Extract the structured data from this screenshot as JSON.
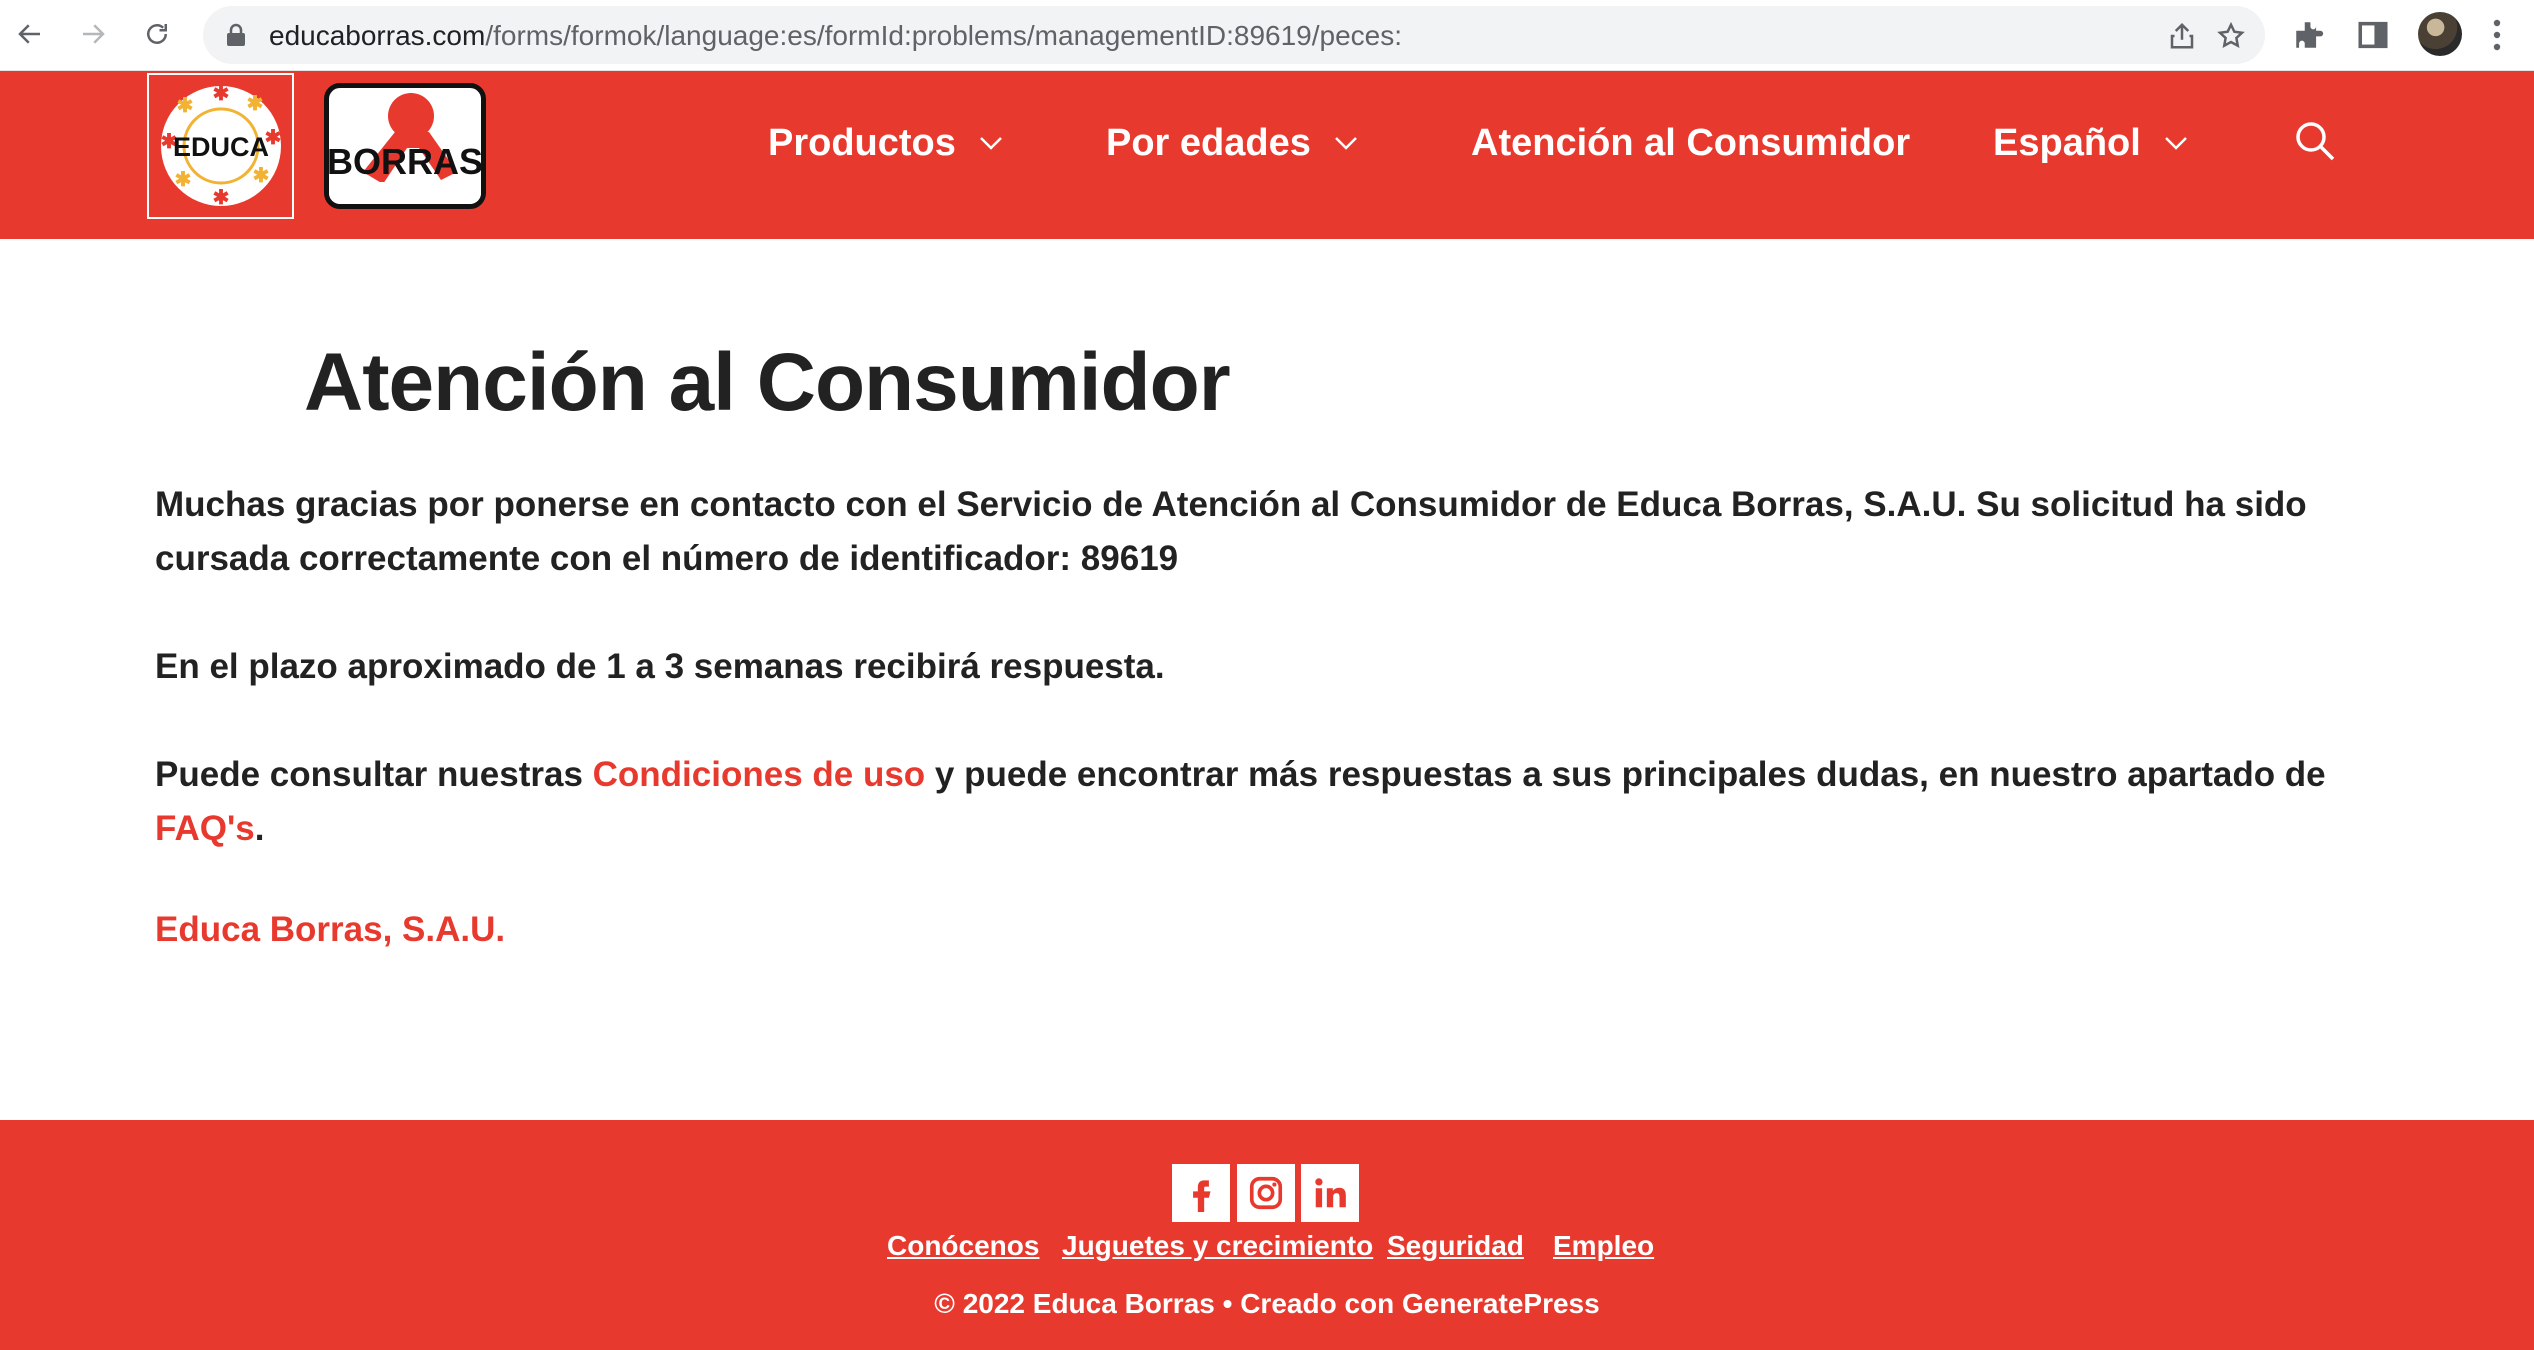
{
  "browser": {
    "url_host": "educaborras.com",
    "url_path": "/forms/formok/language:es/formId:problems/managementID:89619/peces:",
    "icons": [
      "back-icon",
      "forward-icon",
      "reload-icon",
      "lock-icon",
      "share-icon",
      "bookmark-star-icon",
      "extensions-icon",
      "side-panel-icon",
      "profile-avatar",
      "menu-kebab-icon"
    ]
  },
  "header": {
    "logo_educa_text": "EDUCA",
    "logo_borras_text": "BORRAS",
    "menu": [
      {
        "label": "Productos",
        "has_dropdown": true
      },
      {
        "label": "Por edades",
        "has_dropdown": true
      },
      {
        "label": "Atención al Consumidor",
        "has_dropdown": false
      },
      {
        "label": "Español",
        "has_dropdown": true
      }
    ]
  },
  "main": {
    "title": "Atención al Consumidor",
    "p1": "Muchas gracias por ponerse en contacto con el Servicio de Atención al Consumidor de Educa Borras, S.A.U. Su solicitud ha sido cursada correctamente con el número de identificador: 89619",
    "p2": "En el plazo aproximado de 1 a 3 semanas recibirá respuesta.",
    "p3_before": "Puede consultar nuestras ",
    "p3_link1": "Condiciones de uso",
    "p3_middle": " y puede encontrar más respuestas a sus principales dudas, en nuestro apartado de ",
    "p3_link2": "FAQ's",
    "p3_after": ".",
    "signature": "Educa Borras, S.A.U."
  },
  "footer": {
    "social": [
      "facebook-icon",
      "instagram-icon",
      "linkedin-icon"
    ],
    "links": [
      "Conócenos",
      "Juguetes y crecimiento",
      "Seguridad",
      "Empleo"
    ],
    "copyright": "© 2022 Educa Borras • Creado con GeneratePress"
  },
  "colors": {
    "brand_red": "#e8392e",
    "text_dark": "#222222",
    "white": "#ffffff"
  }
}
